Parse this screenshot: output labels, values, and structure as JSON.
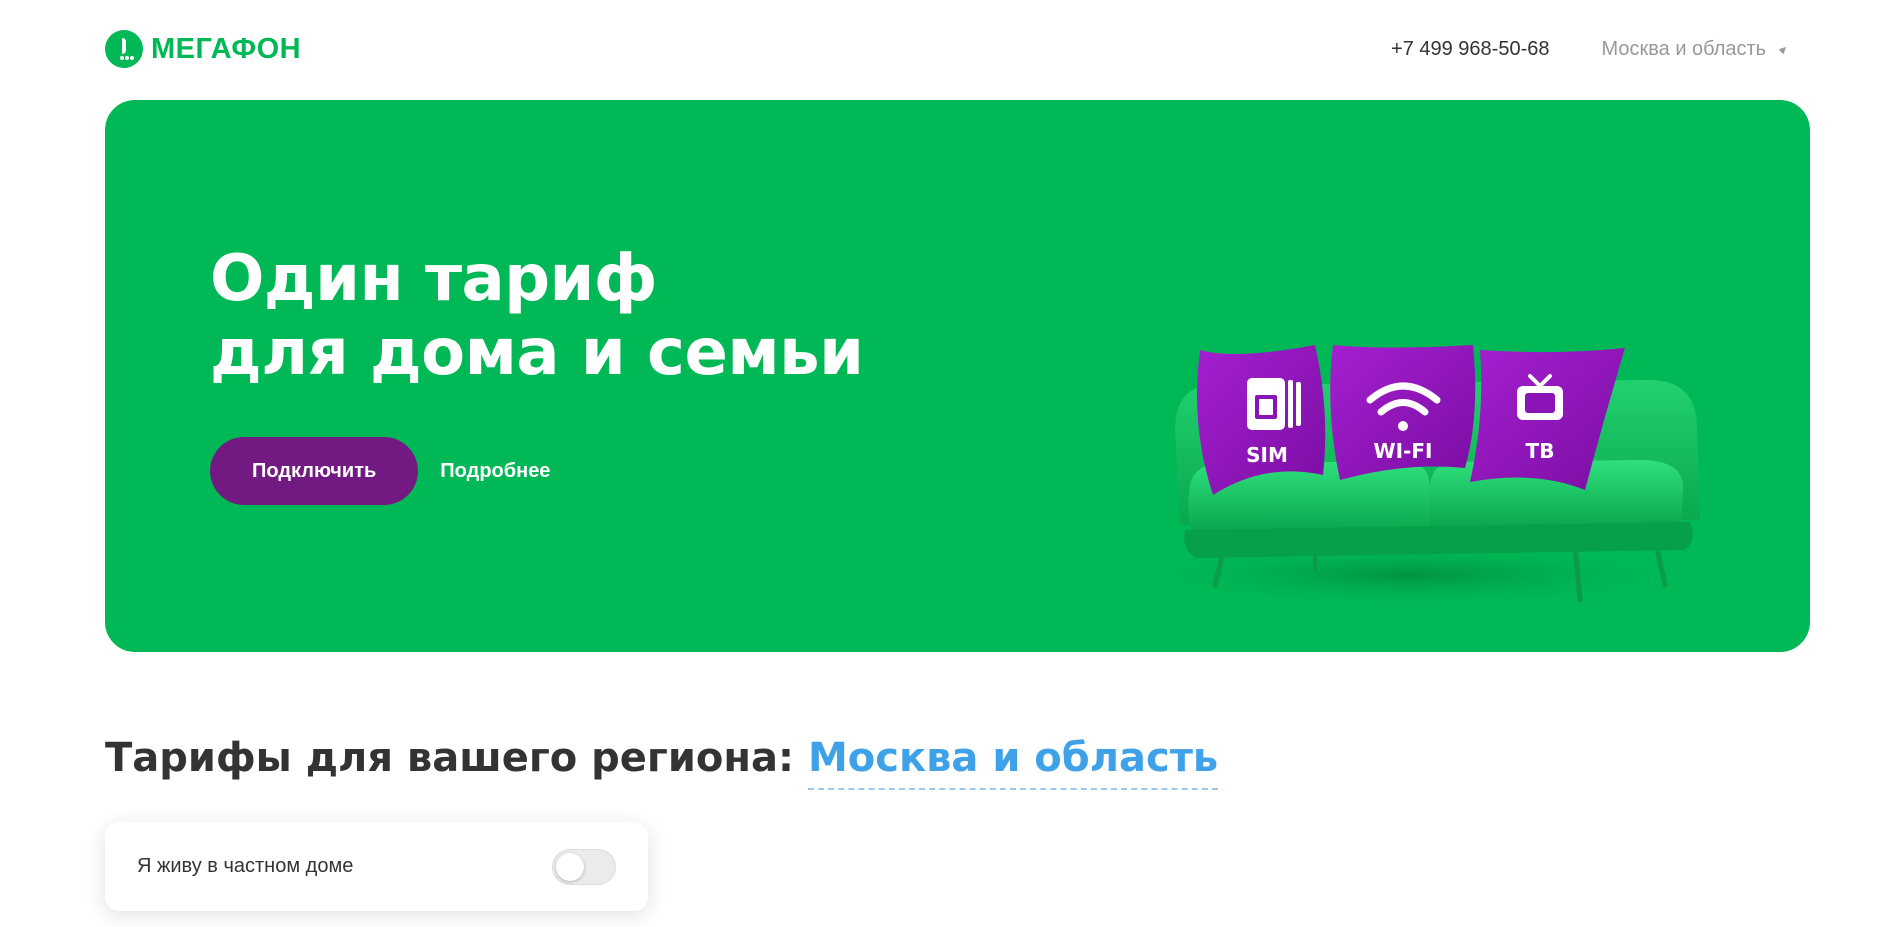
{
  "brand": {
    "logo_text": "МегаФон",
    "primary_color": "#00b956",
    "accent_color": "#731982"
  },
  "header": {
    "phone": "+7 499 968-50-68",
    "region": "Москва и область",
    "region_icon": "location-arrow-icon"
  },
  "hero": {
    "title_line1": "Один тариф",
    "title_line2": "для дома и семьи",
    "connect_label": "Подключить",
    "more_label": "Подробнее",
    "illustration": {
      "pillows": [
        "SIM",
        "WI-FI",
        "ТВ"
      ],
      "pillow_icons": [
        "sim-card-icon",
        "wifi-icon",
        "tv-icon"
      ]
    }
  },
  "tariffs": {
    "title": "Тарифы для вашего региона:",
    "region_link": "Москва и область",
    "region_link_color": "#3fa2e8"
  },
  "private_house": {
    "label": "Я живу в частном доме",
    "enabled": false
  }
}
